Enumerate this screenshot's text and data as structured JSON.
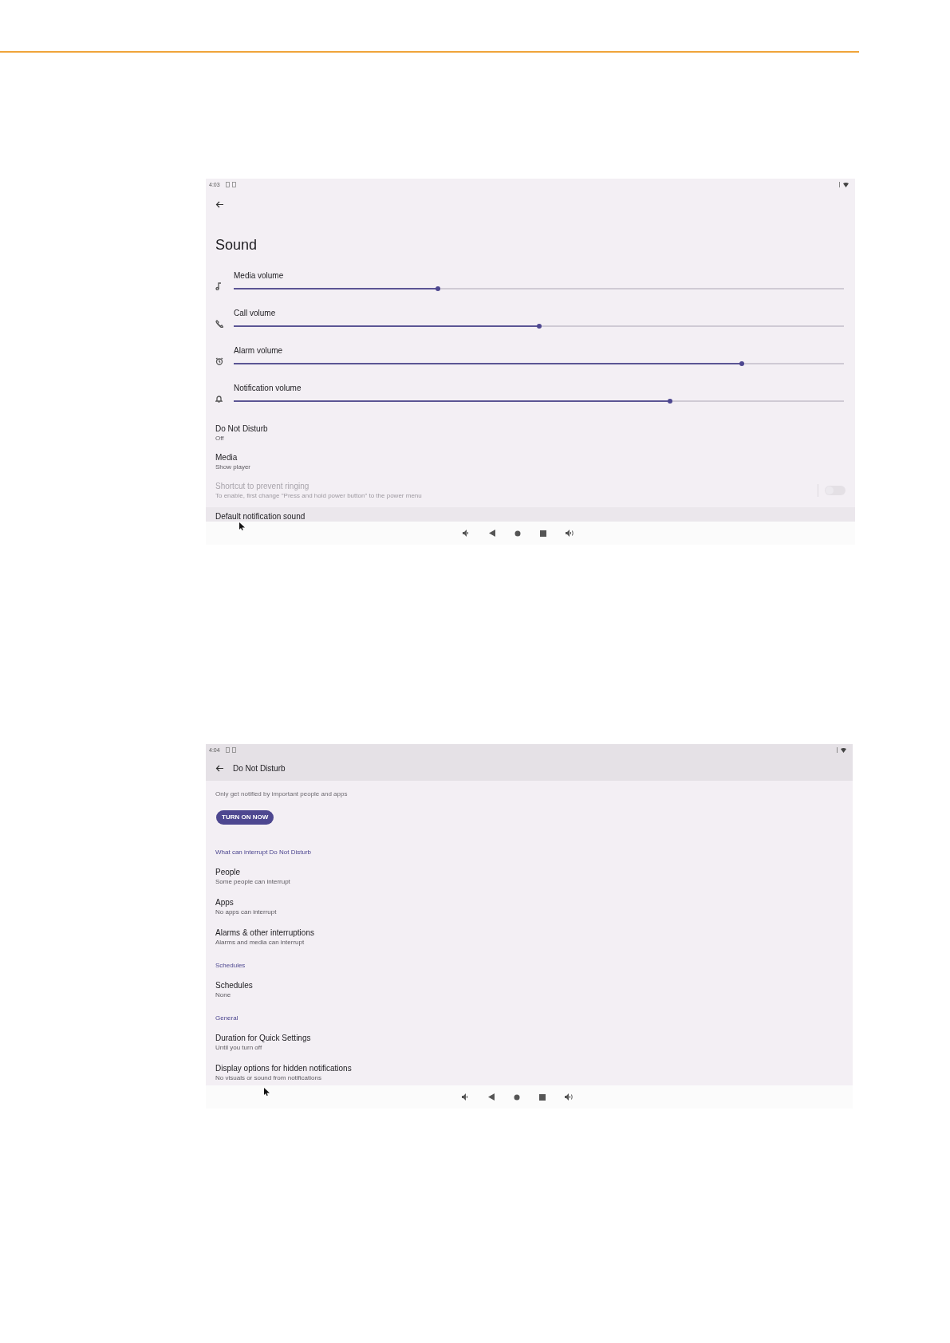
{
  "sound_screen": {
    "status_time": "4:03",
    "title": "Sound",
    "sliders": [
      {
        "label": "Media volume",
        "level": 0.334
      },
      {
        "label": "Call volume",
        "level": 0.5
      },
      {
        "label": "Alarm volume",
        "level": 0.833
      },
      {
        "label": "Notification volume",
        "level": 0.715
      }
    ],
    "items": [
      {
        "title": "Do Not Disturb",
        "subtitle": "Off",
        "disabled": false,
        "pressed": false
      },
      {
        "title": "Media",
        "subtitle": "Show player",
        "disabled": false,
        "pressed": false
      },
      {
        "title": "Shortcut to prevent ringing",
        "subtitle": "To enable, first change \"Press and hold power button\" to the power menu",
        "disabled": true,
        "pressed": false,
        "switch": {
          "on": false
        }
      },
      {
        "title": "Default notification sound",
        "disabled": false,
        "pressed": true
      }
    ]
  },
  "dnd_screen": {
    "status_time": "4:04",
    "title": "Do Not Disturb",
    "description": "Only get notified by important people and apps",
    "button": "TURN ON NOW",
    "groups": [
      {
        "heading": "What can interrupt Do Not Disturb",
        "items": [
          {
            "title": "People",
            "subtitle": "Some people can interrupt"
          },
          {
            "title": "Apps",
            "subtitle": "No apps can interrupt"
          },
          {
            "title": "Alarms & other interruptions",
            "subtitle": "Alarms and media can interrupt"
          }
        ]
      },
      {
        "heading": "Schedules",
        "items": [
          {
            "title": "Schedules",
            "subtitle": "None"
          }
        ]
      },
      {
        "heading": "General",
        "items": [
          {
            "title": "Duration for Quick Settings",
            "subtitle": "Until you turn off"
          },
          {
            "title": "Display options for hidden notifications",
            "subtitle": "No visuals or sound from notifications"
          }
        ]
      }
    ]
  }
}
